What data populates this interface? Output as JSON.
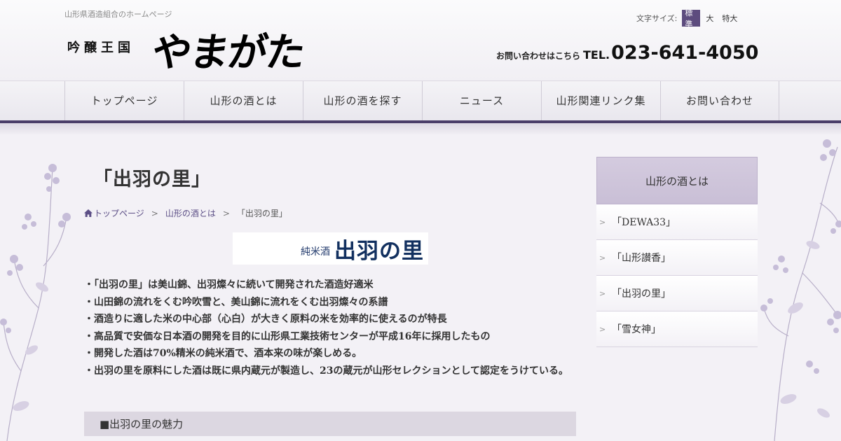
{
  "header": {
    "tagline": "山形県酒造組合のホームページ",
    "logo_sub": "吟醸王国",
    "logo_main": "やまがた",
    "font_size": {
      "label": "文字サイズ:",
      "options": [
        "標準",
        "大",
        "特大"
      ],
      "selected": "標準"
    },
    "contact": {
      "label": "お問い合わせはこちら",
      "tel_prefix": "TEL.",
      "tel": "023-641-4050"
    }
  },
  "nav": {
    "items": [
      "トップページ",
      "山形の酒とは",
      "山形の酒を探す",
      "ニュース",
      "山形関連リンク集",
      "お問い合わせ"
    ]
  },
  "main": {
    "title": "「出羽の里」",
    "breadcrumb": {
      "home": "トップページ",
      "parent": "山形の酒とは",
      "current": "「出羽の里」",
      "separator": ">"
    },
    "banner": {
      "small": "純米酒",
      "big": "出羽の里"
    },
    "bullets": [
      "・「出羽の里」は美山錦、出羽燦々に続いて開発された酒造好適米",
      "・山田錦の流れをくむ吟吹雪と、美山錦に流れをくむ出羽燦々の系譜",
      "・酒造りに適した米の中心部（心白）が大きく原料の米を効率的に使えるのが特長",
      "・高品質で安価な日本酒の開発を目的に山形県工業技術センターが平成16年に採用したもの",
      "・開発した酒は70%精米の純米酒で、酒本来の味が楽しめる。",
      "・出羽の里を原料にした酒は既に県内蔵元が製造し、23の蔵元が山形セレクションとして認定をうけている。"
    ],
    "section_heading": "■出羽の里の魅力"
  },
  "sidebar": {
    "heading": "山形の酒とは",
    "items": [
      "「DEWA33」",
      "「山形讃香」",
      "「出羽の里」",
      "「雪女神」"
    ]
  },
  "colors": {
    "accent": "#4a3e69",
    "nav_active": "#5d4c7e",
    "link": "#5c4f86",
    "banner_text": "#12305f"
  }
}
